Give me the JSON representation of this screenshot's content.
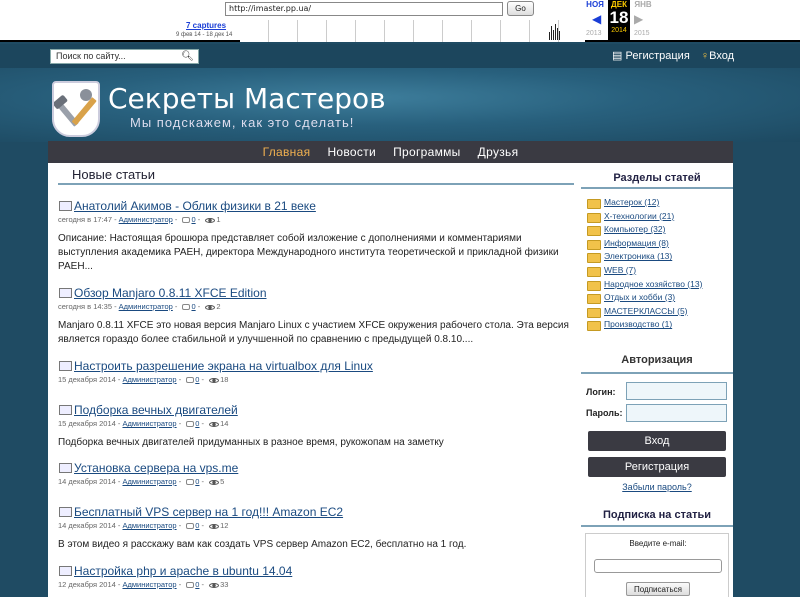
{
  "wayback": {
    "url": "http://imaster.pp.ua/",
    "go_label": "Go",
    "captures": "7 captures",
    "range": "9 фев 14 - 18 дек 14",
    "prev_month": "НОЯ",
    "cur_month": "ДЕК",
    "cur_day": "18",
    "cur_year": "2014",
    "next_month": "ЯНВ",
    "prev_year": "2013",
    "next_year": "2015"
  },
  "topbar": {
    "search_placeholder": "Поиск по сайту...",
    "register": "Регистрация",
    "login": "Вход"
  },
  "header": {
    "title": "Секреты Мастеров",
    "subtitle": "Мы подскажем, как это сделать!"
  },
  "nav": [
    "Главная",
    "Новости",
    "Программы",
    "Друзья"
  ],
  "main": {
    "heading": "Новые статьи",
    "articles": [
      {
        "title": "Анатолий Акимов - Облик физики в 21 веке",
        "date": "сегодня в 17:47",
        "author": "Администратор",
        "comments": "0",
        "views": "1",
        "text": "Описание: Настоящая брошюра представляет собой изложение с дополнениями и комментариями выступления академика РАЕН, директора Международного института теоретической и прикладной физики РАЕН..."
      },
      {
        "title": "Обзор Manjaro 0.8.11 XFCE Edition",
        "date": "сегодня в 14:35",
        "author": "Администратор",
        "comments": "0",
        "views": "2",
        "text": "Manjaro 0.8.11 XFCE это новая версия Manjaro Linux с участием XFCE окружения рабочего стола. Эта версия является гораздо более стабильной и улучшенной по сравнению с предыдущей 0.8.10...."
      },
      {
        "title": "Настроить разрешение экрана на virtualbox для Linux",
        "date": "15 декабря 2014",
        "author": "Администратор",
        "comments": "0",
        "views": "18",
        "text": ""
      },
      {
        "title": "Подборка вечных двигателей",
        "date": "15 декабря 2014",
        "author": "Администратор",
        "comments": "0",
        "views": "14",
        "text": "Подборка вечных двигателей придуманных в разное время, рукожопам на заметку"
      },
      {
        "title": "Установка сервера на vps.me",
        "date": "14 декабря 2014",
        "author": "Администратор",
        "comments": "0",
        "views": "5",
        "text": ""
      },
      {
        "title": "Бесплатный VPS сервер на 1 год!!! Amazon EC2",
        "date": "14 декабря 2014",
        "author": "Администратор",
        "comments": "0",
        "views": "12",
        "text": "В этом видео я расскажу вам как создать VPS сервер Amazon EC2, бесплатно на 1 год."
      },
      {
        "title": "Настройка php и apache в ubuntu 14.04",
        "date": "12 декабря 2014",
        "author": "Администратор",
        "comments": "0",
        "views": "33",
        "text": ""
      }
    ]
  },
  "sidebar": {
    "sections_title": "Разделы статей",
    "categories": [
      "Мастерок (12)",
      "X-технологии (21)",
      "Компьютер (32)",
      "Информация (8)",
      "Электроника (13)",
      "WEB (7)",
      "Народное хозяйство (13)",
      "Отдых и хобби (3)",
      "МАСТЕРКЛАССЫ (5)",
      "Производство (1)"
    ],
    "auth_title": "Авторизация",
    "login_label": "Логин:",
    "password_label": "Пароль:",
    "login_button": "Вход",
    "register_button": "Регистрация",
    "forgot": "Забыли пароль?",
    "subscribe_title": "Подписка на статьи",
    "email_label": "Введите e-mail:",
    "subscribe_button": "Подписаться"
  }
}
